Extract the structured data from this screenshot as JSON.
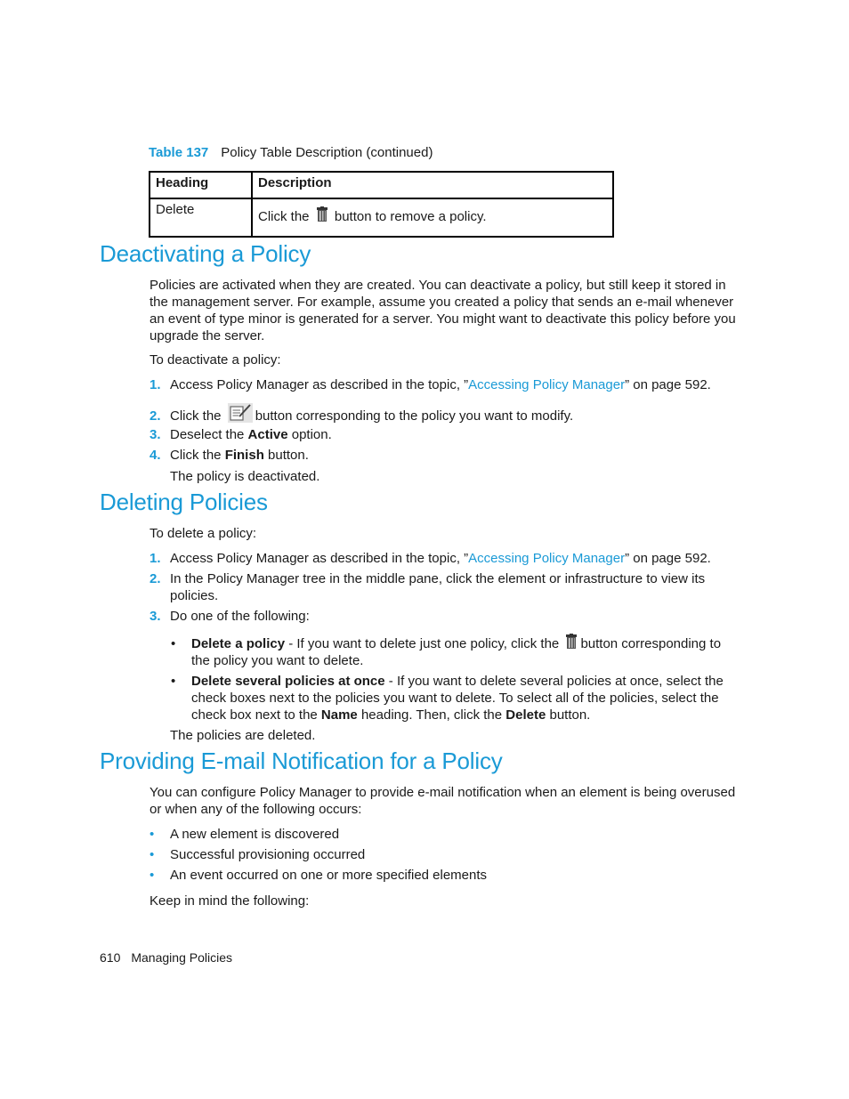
{
  "table": {
    "caption_label": "Table 137",
    "caption_text": "Policy Table Description (continued)",
    "headers": [
      "Heading",
      "Description"
    ],
    "rows": [
      {
        "heading": "Delete",
        "desc_before": "Click the",
        "icon": "trash-icon",
        "desc_after": "button to remove a policy."
      }
    ]
  },
  "deactivating": {
    "title": "Deactivating a Policy",
    "intro_lines": [
      "Policies are activated when they are created. You can deactivate a policy, but still keep it stored in",
      "the management server. For example, assume you created a policy that sends an e-mail whenever",
      "an event of type minor is generated for a server. You might want to deactivate this policy before you",
      "upgrade the server."
    ],
    "lead": "To deactivate a policy:",
    "steps": [
      {
        "num": "1.",
        "before": "Access Policy Manager as described in the topic, ”",
        "link": "Accessing Policy Manager",
        "after": "” on page 592."
      },
      {
        "num": "2.",
        "before": "Click the",
        "icon": "edit-icon",
        "after": "button corresponding to the policy you want to modify."
      },
      {
        "num": "3.",
        "before": "Deselect the ",
        "bold": "Active",
        "after": " option."
      },
      {
        "num": "4.",
        "before": "Click the ",
        "bold": "Finish",
        "after": " button."
      }
    ],
    "result": "The policy is deactivated."
  },
  "deleting": {
    "title": "Deleting Policies",
    "lead": "To delete a policy:",
    "steps": [
      {
        "num": "1.",
        "before": "Access Policy Manager as described in the topic, ”",
        "link": "Accessing Policy Manager",
        "after": "” on page 592."
      },
      {
        "num": "2.",
        "line1": "In the Policy Manager tree in the middle pane, click the element or infrastructure to view its",
        "line2": "policies."
      },
      {
        "num": "3.",
        "text": "Do one of the following:"
      }
    ],
    "options": [
      {
        "bold": "Delete a policy",
        "before": " - If you want to delete just one policy, click the",
        "icon": "trash-icon",
        "after": "button corresponding to",
        "line2": "the policy you want to delete."
      },
      {
        "bold": "Delete several policies at once",
        "line1": " - If you want to delete several policies at once, select the",
        "line2": "check boxes next to the policies you want to delete. To select all of the policies, select the",
        "line3_before": "check box next to the ",
        "line3_bold1": "Name",
        "line3_mid": " heading. Then, click the ",
        "line3_bold2": "Delete",
        "line3_after": " button."
      }
    ],
    "result": "The policies are deleted."
  },
  "email": {
    "title": "Providing E-mail Notification for a Policy",
    "intro_lines": [
      "You can configure Policy Manager to provide e-mail notification when an element is being overused",
      "or when any of the following occurs:"
    ],
    "bullets": [
      "A new element is discovered",
      "Successful provisioning occurred",
      "An event occurred on one or more specified elements"
    ],
    "closing": "Keep in mind the following:"
  },
  "footer": {
    "page_number": "610",
    "section": "Managing Policies"
  }
}
